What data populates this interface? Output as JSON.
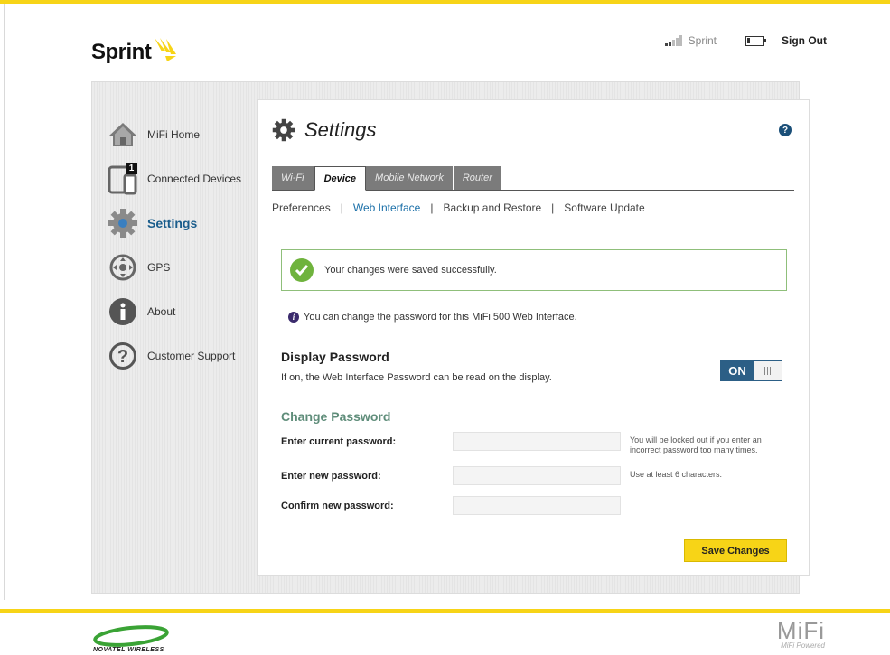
{
  "header": {
    "brand": "Sprint",
    "carrier": "Sprint",
    "sign_out": "Sign Out"
  },
  "sidebar": {
    "items": [
      {
        "label": "MiFi Home",
        "icon": "home-icon"
      },
      {
        "label": "Connected Devices",
        "icon": "devices-icon",
        "badge": "1"
      },
      {
        "label": "Settings",
        "icon": "gear-icon",
        "active": true
      },
      {
        "label": "GPS",
        "icon": "gps-icon"
      },
      {
        "label": "About",
        "icon": "info-icon"
      },
      {
        "label": "Customer Support",
        "icon": "question-icon"
      }
    ]
  },
  "main": {
    "title": "Settings",
    "help": "?",
    "tabs": [
      {
        "label": "Wi-Fi"
      },
      {
        "label": "Device",
        "active": true
      },
      {
        "label": "Mobile Network"
      },
      {
        "label": "Router"
      }
    ],
    "subtabs": [
      {
        "label": "Preferences"
      },
      {
        "label": "Web Interface",
        "active": true
      },
      {
        "label": "Backup and Restore"
      },
      {
        "label": "Software Update"
      }
    ],
    "success_message": "Your changes were saved successfully.",
    "info_message": "You can change the password for this MiFi 500 Web Interface.",
    "display_password": {
      "title": "Display Password",
      "description": "If on, the Web Interface Password can be read on the display.",
      "toggle_label": "ON",
      "toggle_state": "on"
    },
    "change_password": {
      "title": "Change Password",
      "current_label": "Enter current password:",
      "current_hint": "You will be locked out if you enter an incorrect password too many times.",
      "new_label": "Enter new password:",
      "new_hint": "Use at least 6 characters.",
      "confirm_label": "Confirm new password:"
    },
    "save_button": "Save Changes"
  },
  "footer": {
    "novatel": "NOVATEL WIRELESS",
    "mifi": "MiFi",
    "mifi_sub": "MiFi Powered"
  },
  "colors": {
    "accent_yellow": "#f7d417",
    "active_blue": "#1a5d8c",
    "success_green": "#6fb33d",
    "section_green": "#5f8d7a"
  }
}
